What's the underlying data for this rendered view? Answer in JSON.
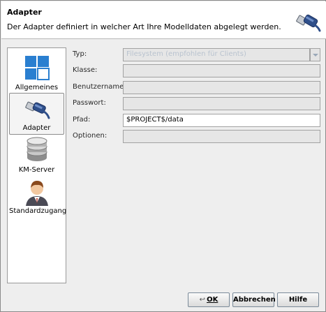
{
  "header": {
    "title": "Adapter",
    "description": "Der Adapter definiert in welcher Art Ihre Modelldaten abgelegt werden.",
    "icon": "usb-plug-icon"
  },
  "sidebar": {
    "items": [
      {
        "label": "Allgemeines",
        "icon": "windows-tiles-icon",
        "selected": false
      },
      {
        "label": "Adapter",
        "icon": "usb-plug-icon",
        "selected": true
      },
      {
        "label": "KM-Server",
        "icon": "database-icon",
        "selected": false
      },
      {
        "label": "Standardzugang",
        "icon": "user-icon",
        "selected": false
      }
    ]
  },
  "form": {
    "typ": {
      "label": "Typ:",
      "value": "Filesystem (empfohlen für Clients)"
    },
    "klasse": {
      "label": "Klasse:",
      "value": ""
    },
    "benutzername": {
      "label": "Benutzername:",
      "value": ""
    },
    "passwort": {
      "label": "Passwort:",
      "value": ""
    },
    "pfad": {
      "label": "Pfad:",
      "value": "$PROJECT$/data"
    },
    "optionen": {
      "label": "Optionen:",
      "value": ""
    }
  },
  "buttons": {
    "ok": "OK",
    "ok_glyph": "↩",
    "abbrechen": "Abbrechen",
    "hilfe": "Hilfe"
  },
  "colors": {
    "header_bg": "#ffffff",
    "panel_bg": "#eeeeee",
    "disabled_field": "#e6e6e6",
    "combo_placeholder": "#b9c3cf"
  }
}
